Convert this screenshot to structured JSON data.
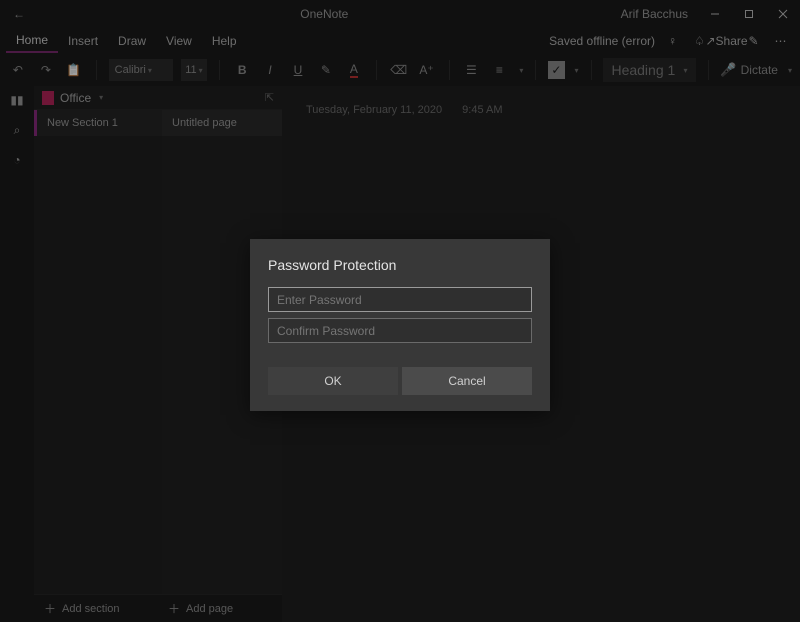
{
  "titlebar": {
    "app_name": "OneNote",
    "user_name": "Arif Bacchus"
  },
  "menubar": {
    "items": [
      "Home",
      "Insert",
      "Draw",
      "View",
      "Help"
    ],
    "active_index": 0,
    "sync_status": "Saved offline (error)",
    "share_label": "Share"
  },
  "ribbon": {
    "font_name": "Calibri",
    "font_size": "11",
    "style_dropdown": "Heading 1",
    "dictate_label": "Dictate"
  },
  "notebook": {
    "name": "Office",
    "sections": [
      {
        "label": "New Section 1"
      }
    ],
    "pages": [
      {
        "label": "Untitled page"
      }
    ],
    "add_section_label": "Add section",
    "add_page_label": "Add page"
  },
  "page": {
    "date": "Tuesday, February 11, 2020",
    "time": "9:45 AM"
  },
  "dialog": {
    "title": "Password Protection",
    "enter_placeholder": "Enter Password",
    "confirm_placeholder": "Confirm Password",
    "ok_label": "OK",
    "cancel_label": "Cancel"
  }
}
